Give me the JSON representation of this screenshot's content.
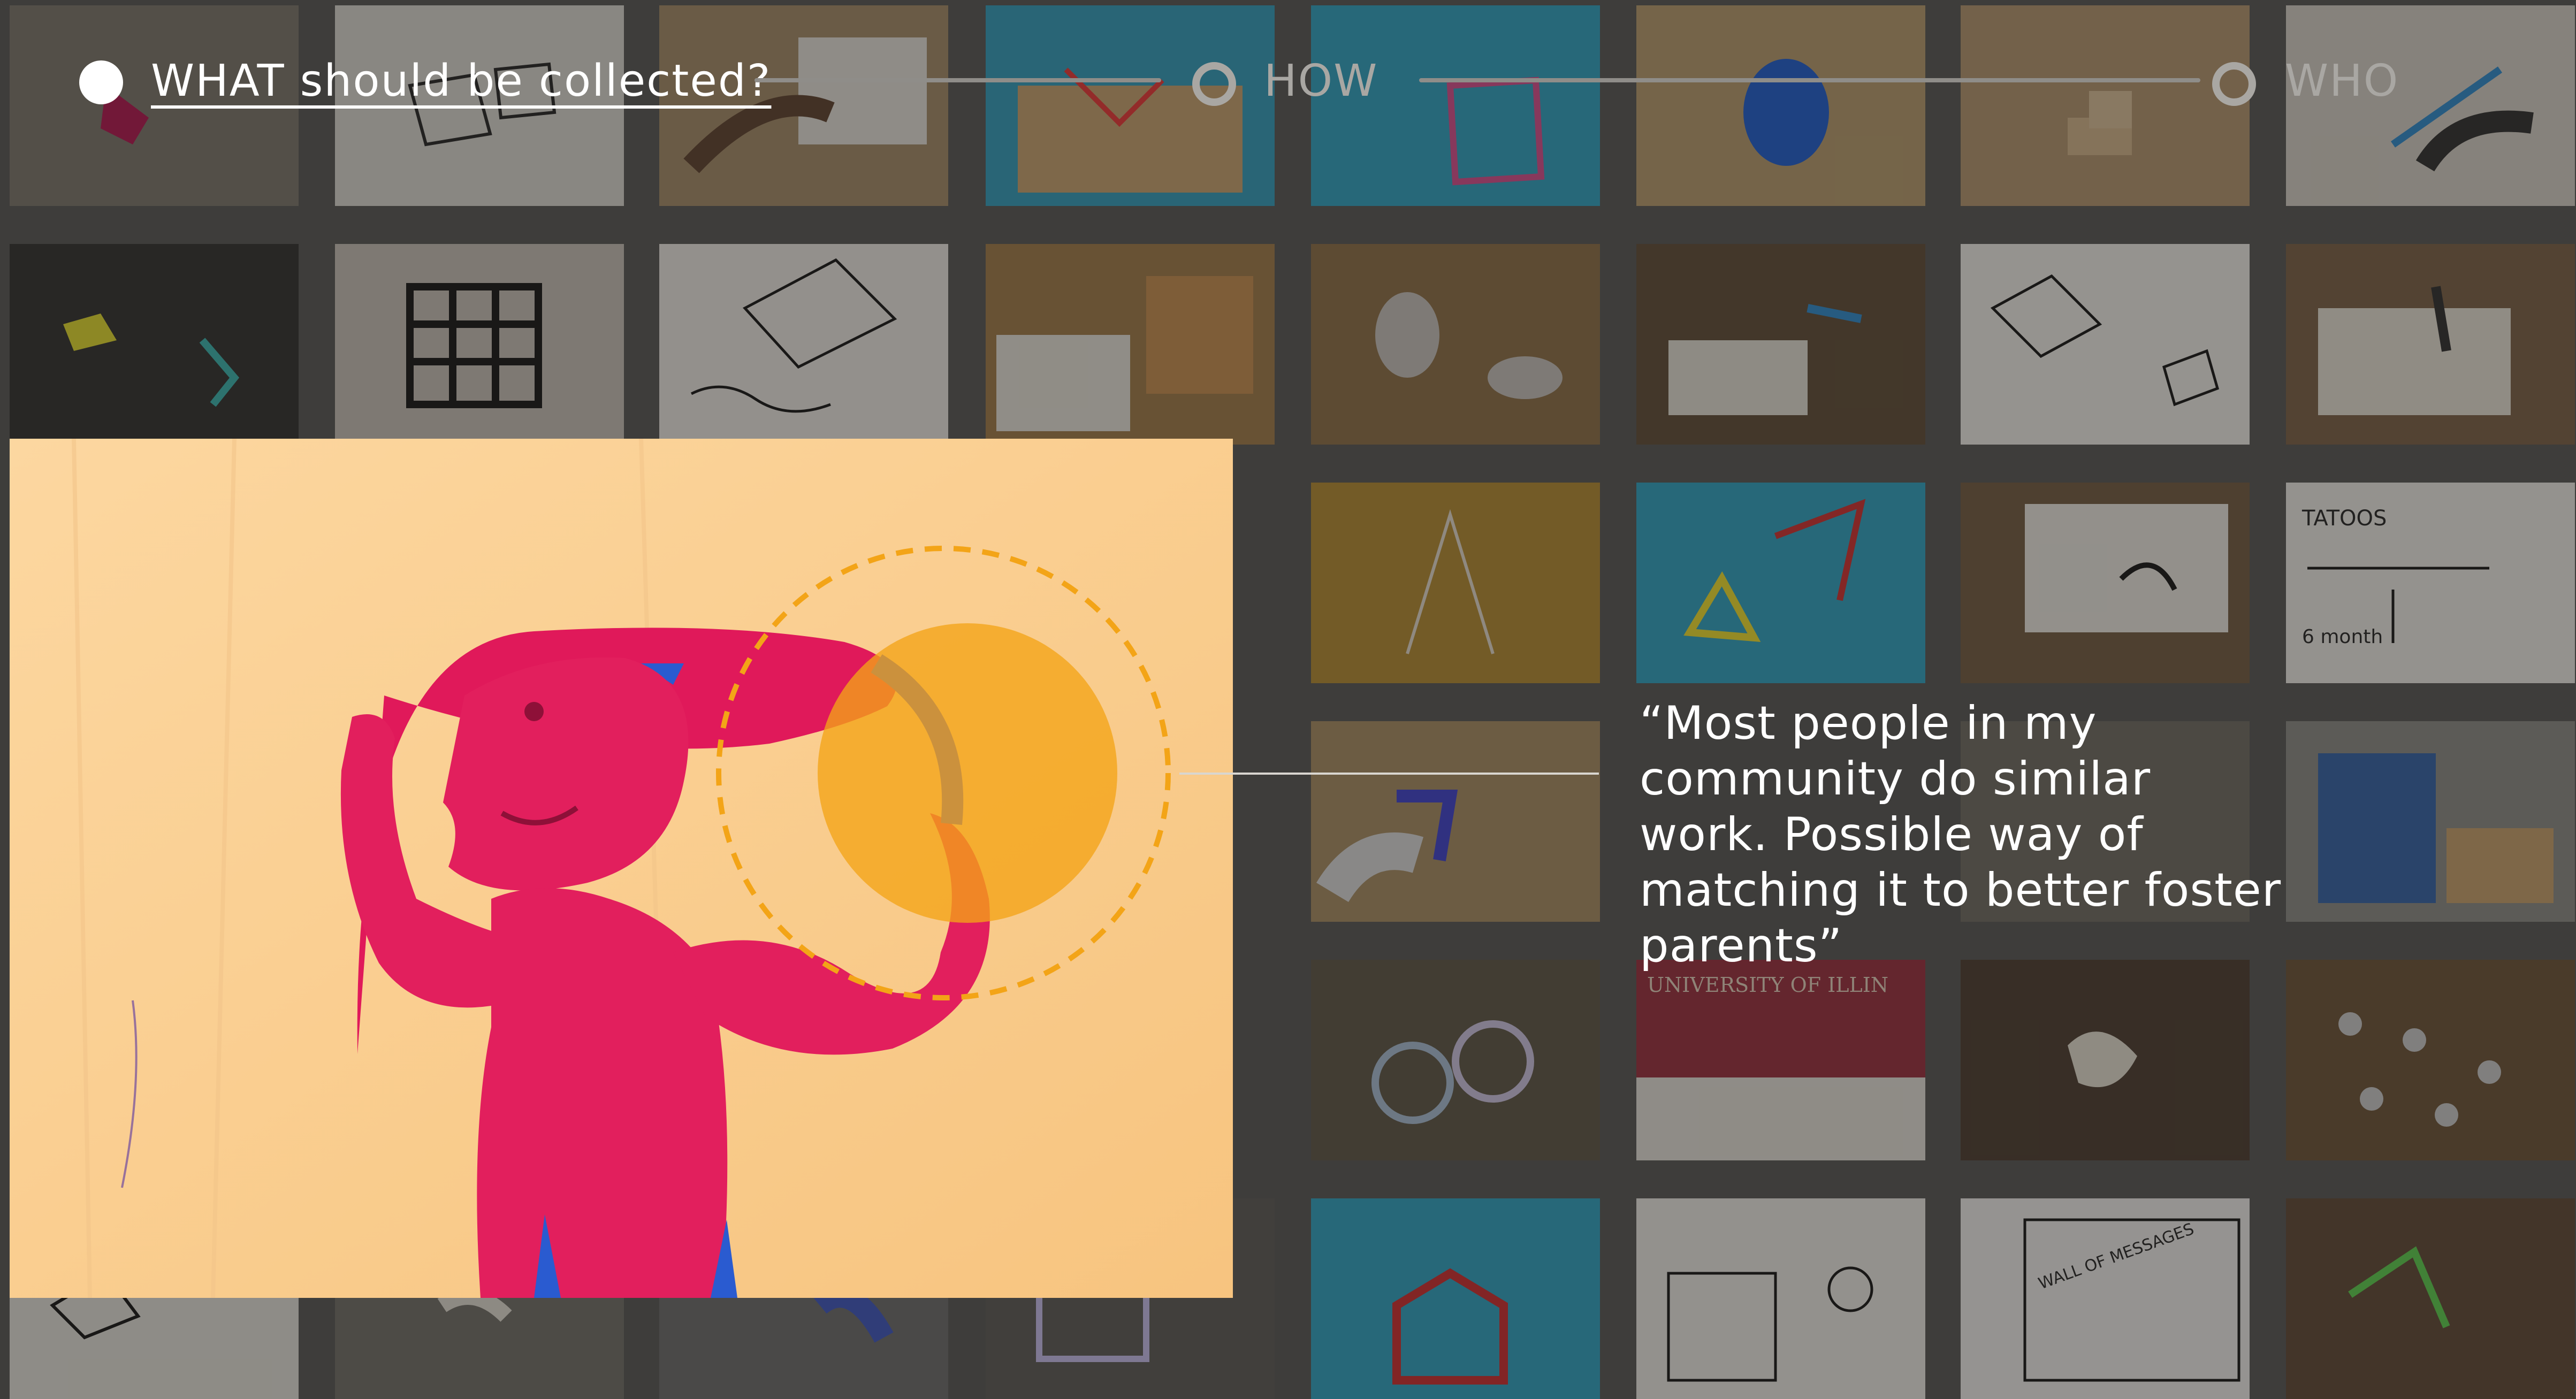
{
  "stepper": {
    "steps": [
      {
        "label": "WHAT should be collected?",
        "state": "active"
      },
      {
        "label": "HOW",
        "state": "inactive"
      },
      {
        "label": "WHO",
        "state": "inactive"
      }
    ]
  },
  "highlight": {
    "quote": "“Most people in my community do similar work. Possible way of matching it to better foster parents”"
  },
  "colors": {
    "background": "#3e3d3b",
    "accent": "#f3a417",
    "active": "#ffffff",
    "inactive": "#a9a7a3"
  },
  "gallery": {
    "thumbnails": [
      {
        "name": "Tattoos sketch",
        "text": "TATOOS"
      },
      {
        "name": "Wall of messages sketch",
        "text": "WALL OF MESSAGES"
      },
      {
        "name": "University sweater",
        "text": "UNIVERSITY OF ILLIN"
      },
      {
        "name": "Timeline sketch",
        "text": "6 month"
      }
    ]
  }
}
